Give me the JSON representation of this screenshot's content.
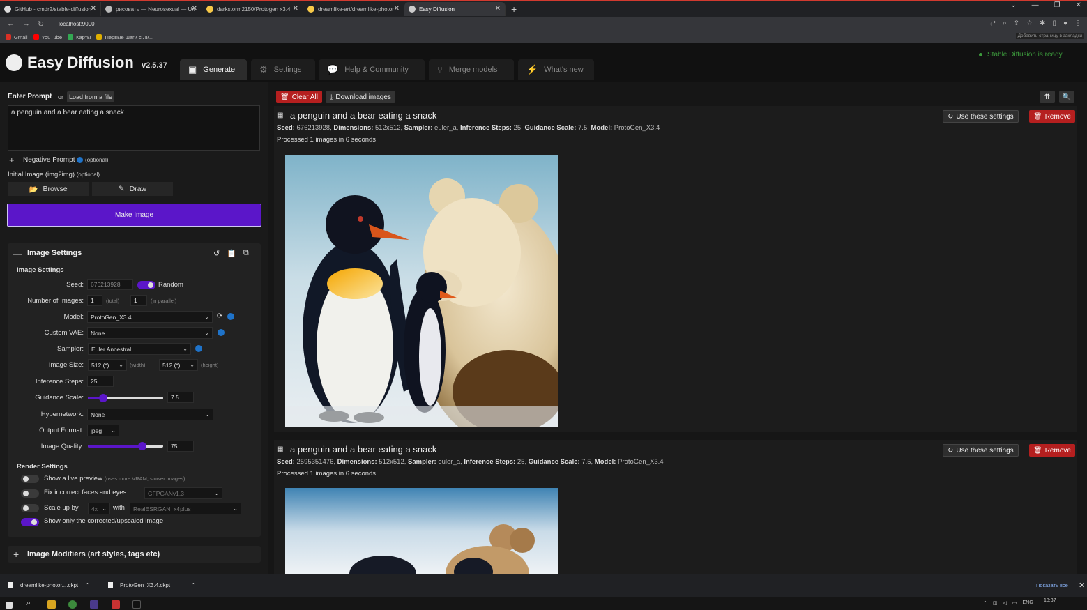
{
  "browser": {
    "tabs": [
      {
        "label": "GitHub - cmdr2/stable-diffusion"
      },
      {
        "label": "рисовать — Neurosexual — Un"
      },
      {
        "label": "darkstorm2150/Protogen x3.4"
      },
      {
        "label": "dreamlike-art/dreamlike-photor"
      },
      {
        "label": "Easy Diffusion"
      }
    ],
    "url": "localhost:9000",
    "bookmarks": [
      {
        "label": "Gmail"
      },
      {
        "label": "YouTube"
      },
      {
        "label": "Карты"
      },
      {
        "label": "Первые шаги с Ли..."
      }
    ],
    "bookmark_hint": "Добавить страницу в закладки"
  },
  "app": {
    "title": "Easy Diffusion",
    "version": "v2.5.37",
    "status": "Stable Diffusion is ready",
    "tabs": [
      {
        "label": "Generate",
        "icon": "image-icon"
      },
      {
        "label": "Settings",
        "icon": "gear-icon"
      },
      {
        "label": "Help & Community",
        "icon": "comments-icon"
      },
      {
        "label": "Merge models",
        "icon": "merge-icon"
      },
      {
        "label": "What's new",
        "icon": "bolt-icon"
      }
    ]
  },
  "left": {
    "prompt_label": "Enter Prompt",
    "or_label": "or",
    "load_file_label": "Load from a file",
    "prompt_value": "a penguin and a bear eating a snack",
    "negative_label": "Negative Prompt",
    "optional": "(optional)",
    "initial_image_label": "Initial Image (img2img)",
    "browse_label": "Browse",
    "draw_label": "Draw",
    "make_image_label": "Make Image",
    "image_settings_header": "Image Settings",
    "image_settings_sub": "Image Settings",
    "seed_label": "Seed:",
    "seed_value": "676213928",
    "random_label": "Random",
    "random_on": true,
    "num_images_label": "Number of Images:",
    "num_total": "1",
    "total_hint": "(total)",
    "num_parallel": "1",
    "parallel_hint": "(in parallel)",
    "model_label": "Model:",
    "model_value": "ProtoGen_X3.4",
    "vae_label": "Custom VAE:",
    "vae_value": "None",
    "sampler_label": "Sampler:",
    "sampler_value": "Euler Ancestral",
    "size_label": "Image Size:",
    "width_value": "512 (*)",
    "width_hint": "(width)",
    "height_value": "512 (*)",
    "height_hint": "(height)",
    "steps_label": "Inference Steps:",
    "steps_value": "25",
    "guidance_label": "Guidance Scale:",
    "guidance_value": "7.5",
    "guidance_fraction": 0.2,
    "hypernetwork_label": "Hypernetwork:",
    "hypernetwork_value": "None",
    "format_label": "Output Format:",
    "format_value": "jpeg",
    "quality_label": "Image Quality:",
    "quality_value": "75",
    "quality_fraction": 0.72,
    "render_settings_sub": "Render Settings",
    "live_preview_label": "Show a live preview",
    "live_preview_hint": "(uses more VRAM, slower images)",
    "fix_faces_label": "Fix incorrect faces and eyes",
    "fix_faces_model": "GFPGANv1.3",
    "scale_label": "Scale up by",
    "scale_value": "4x",
    "with_label": "with",
    "upscaler_value": "RealESRGAN_x4plus",
    "show_corrected_label": "Show only the corrected/upscaled image",
    "modifiers_header": "Image Modifiers (art styles, tags etc)"
  },
  "right": {
    "clear_all_label": "Clear All",
    "download_label": "Download images",
    "cards": [
      {
        "title": "a penguin and a bear eating a snack",
        "seed": "676213928",
        "dimensions": "512x512",
        "sampler": "euler_a",
        "steps": "25",
        "guidance": "7.5",
        "model": "ProtoGen_X3.4",
        "processed": "Processed 1 images in 6 seconds"
      },
      {
        "title": "a penguin and a bear eating a snack",
        "seed": "2595351476",
        "dimensions": "512x512",
        "sampler": "euler_a",
        "steps": "25",
        "guidance": "7.5",
        "model": "ProtoGen_X3.4",
        "processed": "Processed 1 images in 6 seconds"
      }
    ],
    "meta_labels": {
      "seed": "Seed:",
      "dimensions": "Dimensions:",
      "sampler": "Sampler:",
      "steps": "Inference Steps:",
      "guidance": "Guidance Scale:",
      "model": "Model:"
    },
    "use_settings_label": "Use these settings",
    "remove_label": "Remove"
  },
  "downloads": {
    "items": [
      {
        "label": "dreamlike-photor....ckpt"
      },
      {
        "label": "ProtoGen_X3.4.ckpt"
      }
    ],
    "show_all_label": "Показать все"
  },
  "taskbar": {
    "lang": "ENG",
    "time": "18:37"
  },
  "colors": {
    "accent": "#5b16c9",
    "danger": "#b51f1f",
    "ready": "#3c9a3c"
  }
}
